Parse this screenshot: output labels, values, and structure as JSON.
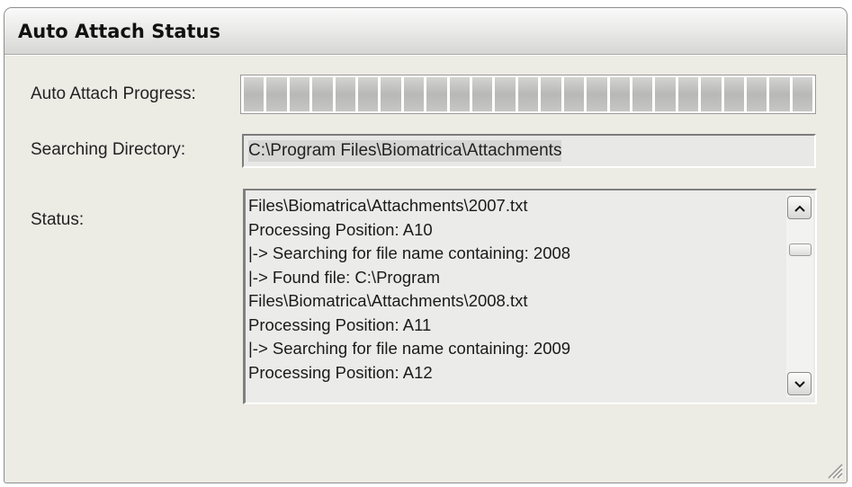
{
  "window": {
    "title": "Auto Attach Status"
  },
  "progress": {
    "label": "Auto Attach Progress:",
    "segments": 25,
    "value_percent": 0
  },
  "directory": {
    "label": "Searching Directory:",
    "value": "C:\\Program Files\\Biomatrica\\Attachments"
  },
  "status": {
    "label": "Status:",
    "lines": [
      "Files\\Biomatrica\\Attachments\\2007.txt",
      "Processing Position: A10",
      "|-> Searching for file name containing: 2008",
      "|-> Found file: C:\\Program",
      "Files\\Biomatrica\\Attachments\\2008.txt",
      "Processing Position: A11",
      "|-> Searching for file name containing: 2009",
      "Processing Position: A12"
    ]
  },
  "icons": {
    "scroll_up": "chevron-up-icon",
    "scroll_down": "chevron-down-icon",
    "resize": "resize-grip-icon"
  },
  "colors": {
    "window_bg": "#ecebe4",
    "progress_segment": "#c4c4c2"
  }
}
